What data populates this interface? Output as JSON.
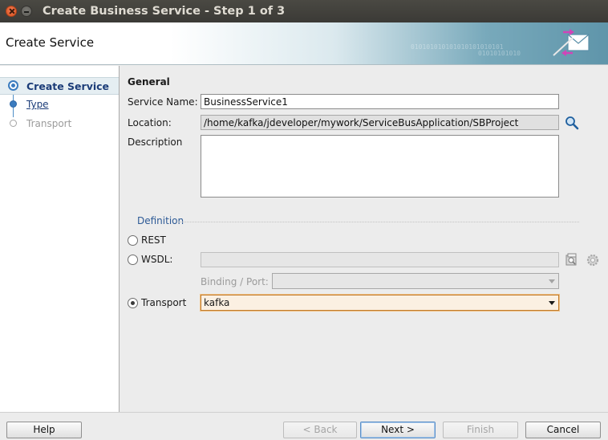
{
  "window": {
    "title": "Create Business Service - Step 1 of 3"
  },
  "header": {
    "title": "Create Service",
    "decor_binary_1": "010101010101010101010101",
    "decor_binary_2": "01010101010"
  },
  "nav": {
    "items": [
      {
        "label": "Create Service",
        "state": "current"
      },
      {
        "label": "Type",
        "state": "link"
      },
      {
        "label": "Transport",
        "state": "disabled"
      }
    ]
  },
  "general": {
    "section_title": "General",
    "service_name_label": "Service Name:",
    "service_name_value": "BusinessService1",
    "location_label": "Location:",
    "location_value": "/home/kafka/jdeveloper/mywork/ServiceBusApplication/SBProject",
    "description_label": "Description",
    "description_value": ""
  },
  "definition": {
    "section_title": "Definition",
    "options": [
      {
        "label": "REST",
        "checked": false
      },
      {
        "label": "WSDL:",
        "checked": false
      },
      {
        "label": "Transport",
        "checked": true
      }
    ],
    "wsdl_value": "",
    "binding_label": "Binding / Port:",
    "binding_value": "",
    "transport_value": "kafka"
  },
  "footer": {
    "help_label": "Help",
    "back_label": "< Back",
    "next_label": "Next >",
    "finish_label": "Finish",
    "cancel_label": "Cancel"
  },
  "colors": {
    "accent": "#1b3c78",
    "train": "#3b7cbf",
    "focus": "#c07b2c"
  },
  "icons": {
    "close": "close-icon",
    "minimize": "minimize-icon",
    "header": "service-envelope-icon",
    "browse": "search-icon",
    "wsdl_browse": "wsdl-browse-icon",
    "wsdl_settings": "gear-icon",
    "train_current": "train-current-icon"
  }
}
